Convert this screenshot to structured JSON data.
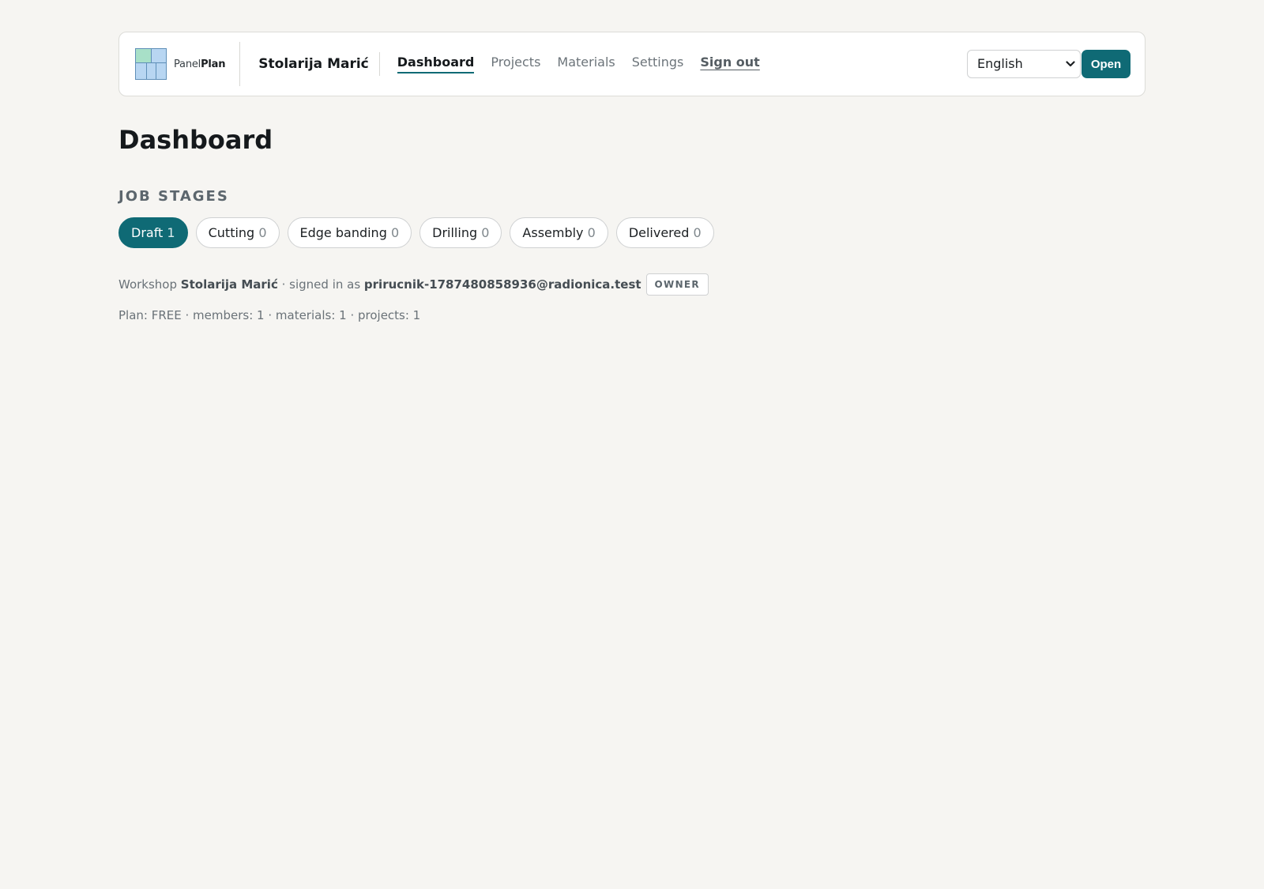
{
  "brand": {
    "name_part1": "Panel",
    "name_part2": "Plan",
    "logo_colors": [
      "#a8e0c8",
      "#b8d6f2",
      "#5f8fb8"
    ]
  },
  "header": {
    "workshop_name": "Stolarija Marić",
    "nav": [
      {
        "label": "Dashboard",
        "active": true
      },
      {
        "label": "Projects",
        "active": false
      },
      {
        "label": "Materials",
        "active": false
      },
      {
        "label": "Settings",
        "active": false
      }
    ],
    "sign_out_label": "Sign out",
    "language": {
      "selected": "English"
    },
    "open_label": "Open"
  },
  "main": {
    "title": "Dashboard",
    "stages_heading": "JOB STAGES",
    "stages": [
      {
        "label": "Draft",
        "count": "1",
        "active": true
      },
      {
        "label": "Cutting",
        "count": "0",
        "active": false
      },
      {
        "label": "Edge banding",
        "count": "0",
        "active": false
      },
      {
        "label": "Drilling",
        "count": "0",
        "active": false
      },
      {
        "label": "Assembly",
        "count": "0",
        "active": false
      },
      {
        "label": "Delivered",
        "count": "0",
        "active": false
      }
    ],
    "workshop_line": {
      "prefix": "Workshop",
      "workshop": "Stolarija Marić",
      "signed_in_text": "· signed in as",
      "email": "prirucnik-1787480858936@radionica.test",
      "role": "OWNER"
    },
    "plan_line": "Plan: FREE · members: 1 · materials: 1 · projects: 1"
  },
  "colors": {
    "accent": "#0f6a75",
    "background": "#f6f5f2"
  }
}
